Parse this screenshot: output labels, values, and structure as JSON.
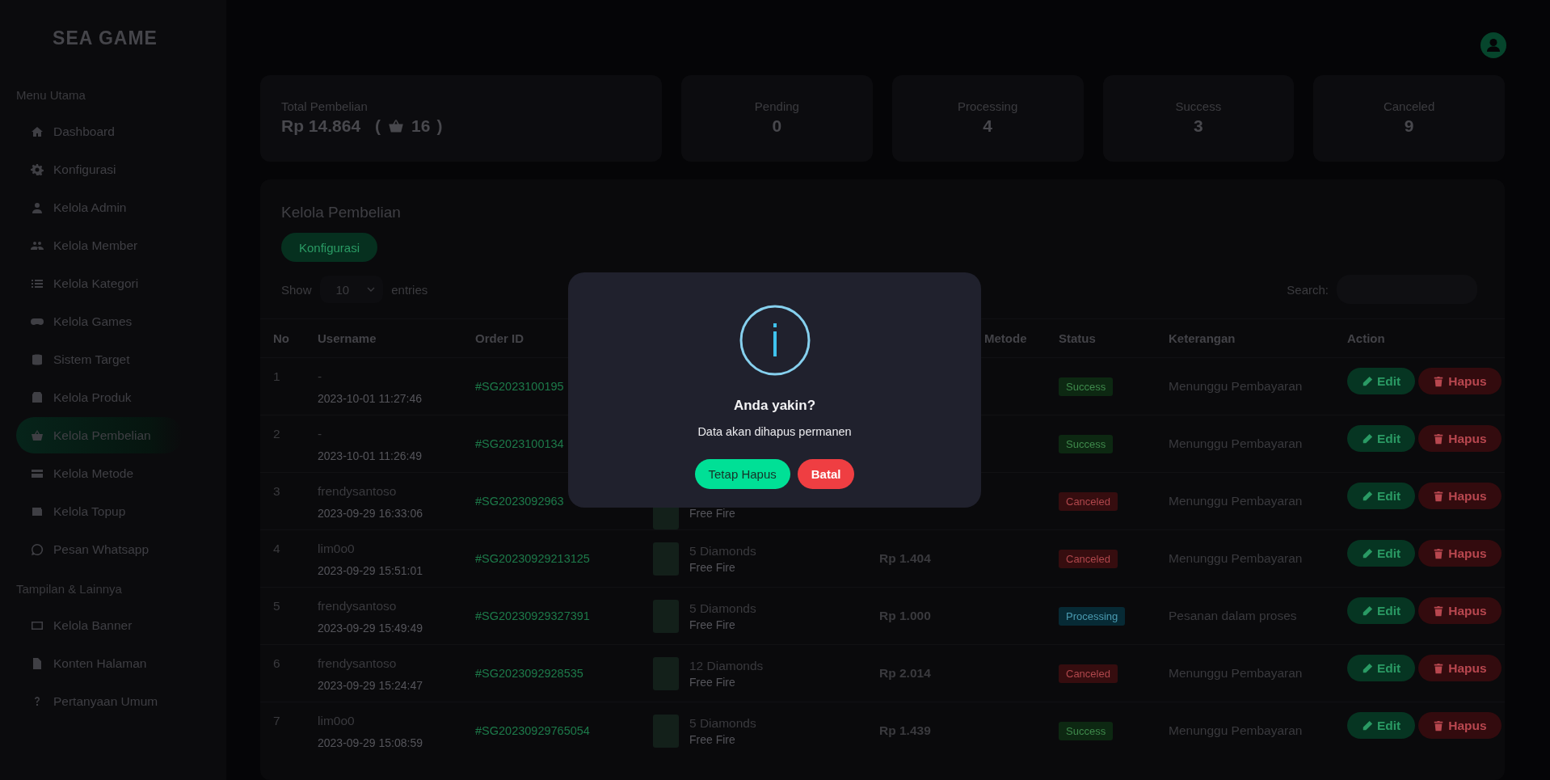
{
  "logo": "SEA GAME",
  "sidebar": {
    "sections": [
      {
        "title": "Menu Utama",
        "items": [
          {
            "label": "Dashboard",
            "selected": false
          },
          {
            "label": "Konfigurasi",
            "selected": false
          },
          {
            "label": "Kelola Admin",
            "selected": false
          },
          {
            "label": "Kelola Member",
            "selected": false
          },
          {
            "label": "Kelola Kategori",
            "selected": false
          },
          {
            "label": "Kelola Games",
            "selected": false
          },
          {
            "label": "Sistem Target",
            "selected": false
          },
          {
            "label": "Kelola Produk",
            "selected": false
          },
          {
            "label": "Kelola Pembelian",
            "selected": true
          },
          {
            "label": "Kelola Metode",
            "selected": false
          },
          {
            "label": "Kelola Topup",
            "selected": false
          },
          {
            "label": "Pesan Whatsapp",
            "selected": false
          }
        ]
      },
      {
        "title": "Tampilan & Lainnya",
        "items": [
          {
            "label": "Kelola Banner",
            "selected": false
          },
          {
            "label": "Konten Halaman",
            "selected": false
          },
          {
            "label": "Pertanyaan Umum",
            "selected": false
          }
        ]
      }
    ]
  },
  "stats": {
    "total": {
      "label": "Total Pembelian",
      "amount": "Rp 14.864",
      "paren_open": "(",
      "count": "16",
      "paren_close": ")"
    },
    "statuses": [
      {
        "label": "Pending",
        "value": "0"
      },
      {
        "label": "Processing",
        "value": "4"
      },
      {
        "label": "Success",
        "value": "3"
      },
      {
        "label": "Canceled",
        "value": "9"
      }
    ]
  },
  "panel": {
    "title": "Kelola Pembelian",
    "button": "Konfigurasi",
    "show": "Show",
    "page_size": "10",
    "entries": "entries",
    "search_label": "Search:",
    "columns": [
      {
        "label": "No"
      },
      {
        "label": "Username"
      },
      {
        "label": "Order ID"
      },
      {
        "label": "Metode"
      },
      {
        "label": "Status"
      },
      {
        "label": "Keterangan"
      },
      {
        "label": "Action"
      }
    ],
    "rows": [
      {
        "no": "1",
        "username": "-",
        "time": "2023-10-01 11:27:46",
        "order_id": "#SG2023100195",
        "status": {
          "label": "Success",
          "kind": "success"
        },
        "note": "Menunggu Pembayaran",
        "actions": [
          "Edit",
          "Hapus"
        ]
      },
      {
        "no": "2",
        "username": "-",
        "time": "2023-10-01 11:26:49",
        "order_id": "#SG2023100134",
        "status": {
          "label": "Success",
          "kind": "success"
        },
        "note": "Menunggu Pembayaran",
        "actions": [
          "Edit",
          "Hapus"
        ]
      },
      {
        "no": "3",
        "username": "frendysantoso",
        "time": "2023-09-29 16:33:06",
        "order_id": "#SG2023092963",
        "game": "Free Fire",
        "status": {
          "label": "Canceled",
          "kind": "canceled"
        },
        "note": "Menunggu Pembayaran",
        "actions": [
          "Edit",
          "Hapus"
        ]
      },
      {
        "no": "4",
        "username": "lim0o0",
        "time": "2023-09-29 15:51:01",
        "order_id": "#SG20230929213125",
        "product": "5 Diamonds",
        "game": "Free Fire",
        "price": "Rp 1.404",
        "status": {
          "label": "Canceled",
          "kind": "canceled"
        },
        "note": "Menunggu Pembayaran",
        "actions": [
          "Edit",
          "Hapus"
        ]
      },
      {
        "no": "5",
        "username": "frendysantoso",
        "time": "2023-09-29 15:49:49",
        "order_id": "#SG20230929327391",
        "product": "5 Diamonds",
        "game": "Free Fire",
        "price": "Rp 1.000",
        "status": {
          "label": "Processing",
          "kind": "processing"
        },
        "note": "Pesanan dalam proses",
        "actions": [
          "Edit",
          "Hapus"
        ]
      },
      {
        "no": "6",
        "username": "frendysantoso",
        "time": "2023-09-29 15:24:47",
        "order_id": "#SG2023092928535",
        "product": "12 Diamonds",
        "game": "Free Fire",
        "price": "Rp 2.014",
        "status": {
          "label": "Canceled",
          "kind": "canceled"
        },
        "note": "Menunggu Pembayaran",
        "actions": [
          "Edit",
          "Hapus"
        ]
      },
      {
        "no": "7",
        "username": "lim0o0",
        "time": "2023-09-29 15:08:59",
        "order_id": "#SG20230929765054",
        "product": "5 Diamonds",
        "game": "Free Fire",
        "price": "Rp 1.439",
        "status": {
          "label": "Success",
          "kind": "success"
        },
        "note": "Menunggu Pembayaran",
        "actions": [
          "Edit",
          "Hapus"
        ]
      }
    ]
  },
  "dialog": {
    "title": "Anda yakin?",
    "text": "Data akan dihapus permanen",
    "confirm": "Tetap Hapus",
    "cancel": "Batal"
  }
}
